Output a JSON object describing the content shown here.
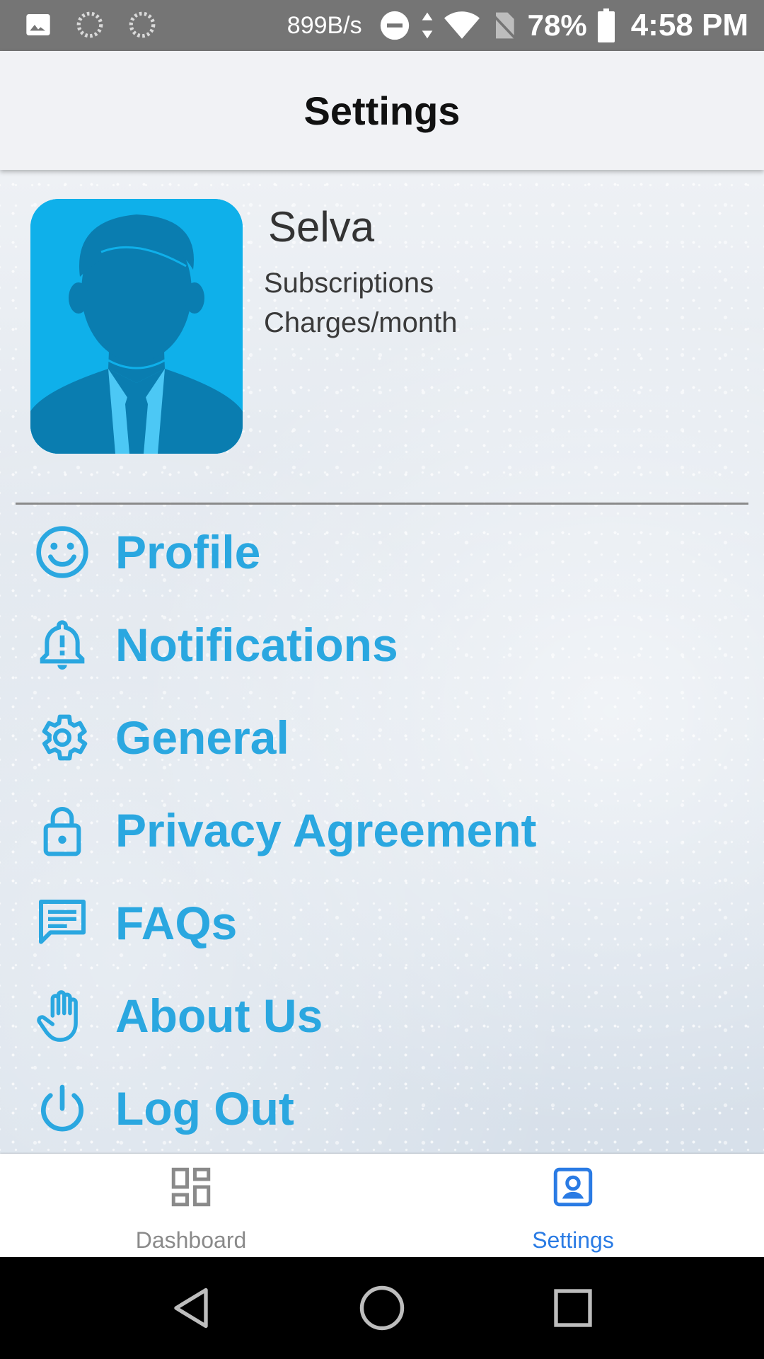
{
  "status_bar": {
    "network_speed": "899B/s",
    "battery_percent": "78%",
    "time": "4:58 PM",
    "icons": [
      "gallery-icon",
      "loading-icon",
      "loading-icon",
      "dnd-icon",
      "data-arrows-icon",
      "wifi-icon",
      "no-sim-icon",
      "battery-icon"
    ]
  },
  "header": {
    "title": "Settings"
  },
  "user": {
    "name": "Selva",
    "line1": "Subscriptions",
    "line2": "Charges/month",
    "avatar_color": "#0fb0ea"
  },
  "menu": {
    "accent_color": "#2aa7e0",
    "items": [
      {
        "label": "Profile",
        "icon": "smiley-icon"
      },
      {
        "label": "Notifications",
        "icon": "bell-alert-icon"
      },
      {
        "label": "General",
        "icon": "gear-icon"
      },
      {
        "label": "Privacy Agreement",
        "icon": "lock-icon"
      },
      {
        "label": "FAQs",
        "icon": "chat-icon"
      },
      {
        "label": "About Us",
        "icon": "hand-icon"
      },
      {
        "label": "Log Out",
        "icon": "power-icon"
      }
    ]
  },
  "bottom_nav": {
    "tabs": [
      {
        "label": "Dashboard",
        "icon": "dashboard-icon",
        "active": false
      },
      {
        "label": "Settings",
        "icon": "account-box-icon",
        "active": true
      }
    ],
    "active_color": "#2a7be4",
    "inactive_color": "#8a8a8a"
  },
  "system_nav": {
    "buttons": [
      "back-icon",
      "home-icon",
      "recents-icon"
    ]
  }
}
